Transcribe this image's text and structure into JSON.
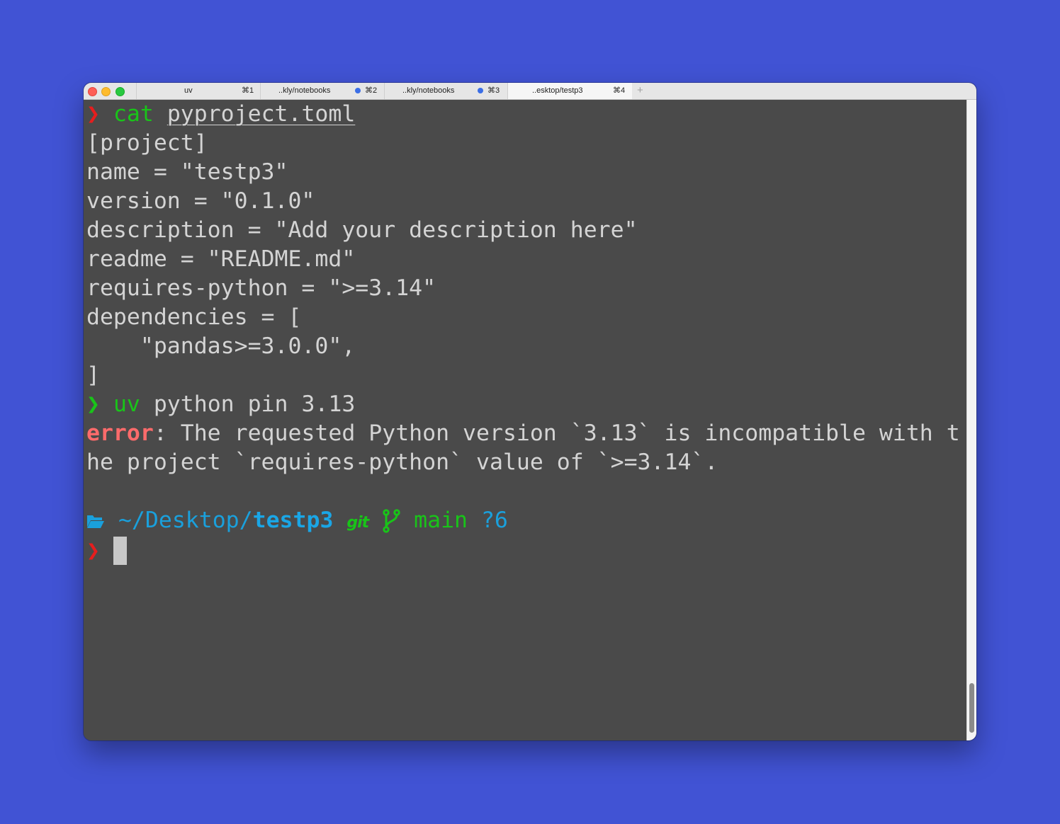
{
  "window": {
    "tabs": [
      {
        "title": "uv",
        "shortcut": "⌘1",
        "has_dot": false,
        "active": false
      },
      {
        "title": "..kly/notebooks",
        "shortcut": "⌘2",
        "has_dot": true,
        "active": false
      },
      {
        "title": "..kly/notebooks",
        "shortcut": "⌘3",
        "has_dot": true,
        "active": false
      },
      {
        "title": "..esktop/testp3",
        "shortcut": "⌘4",
        "has_dot": false,
        "active": true
      }
    ],
    "new_tab_label": "+"
  },
  "terminal": {
    "prompt_char": "❯",
    "cmd1": {
      "program": "cat",
      "argument": "pyproject.toml"
    },
    "file_lines": [
      "[project]",
      "name = \"testp3\"",
      "version = \"0.1.0\"",
      "description = \"Add your description here\"",
      "readme = \"README.md\"",
      "requires-python = \">=3.14\"",
      "dependencies = [",
      "    \"pandas>=3.0.0\",",
      "]"
    ],
    "cmd2": {
      "program": "uv",
      "arguments": " python pin 3.13"
    },
    "error": {
      "label": "error",
      "line1_rest": ": The requested Python version `3.13` is incompatible with t",
      "line2": "he project `requires-python` value of `>=3.14`."
    },
    "status": {
      "path_prefix": " ~/Desktop/",
      "dir": "testp3",
      "git_label": "git",
      "branch": " main",
      "untracked": " ?6"
    }
  },
  "colors": {
    "background": "#4153d4",
    "terminal_bg": "#4a4a4a",
    "prompt_red": "#e61e1e",
    "prompt_green": "#19c419",
    "error_red": "#ff6b6b",
    "path_blue": "#1aa0dc"
  },
  "icons": [
    "folder-icon",
    "git-branch-icon",
    "git-icon",
    "cursor-block"
  ]
}
